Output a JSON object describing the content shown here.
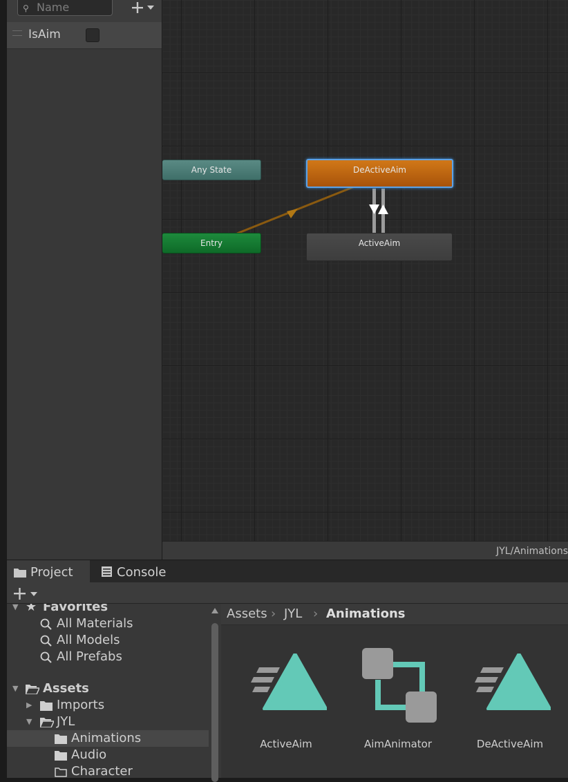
{
  "parameters": {
    "search_placeholder": "Name",
    "add_icon": "plus-icon",
    "items": [
      {
        "name": "IsAim",
        "type": "bool",
        "checked": false
      }
    ]
  },
  "graph": {
    "nodes": {
      "any_state": "Any State",
      "entry": "Entry",
      "deactive_aim": "DeActiveAim",
      "active_aim": "ActiveAim"
    },
    "default_state": "DeActiveAim",
    "path_label": "JYL/Animations"
  },
  "bottom": {
    "tabs": [
      {
        "label": "Project",
        "icon": "folder-icon",
        "active": true
      },
      {
        "label": "Console",
        "icon": "console-icon",
        "active": false
      }
    ],
    "tree": {
      "favorites": {
        "label": "Favorites",
        "items": [
          "All Materials",
          "All Models",
          "All Prefabs"
        ]
      },
      "assets": {
        "label": "Assets",
        "children": [
          "Imports",
          "JYL"
        ],
        "jyl_children": [
          "Animations",
          "Audio",
          "Character"
        ],
        "selected": "Animations"
      }
    },
    "breadcrumb": [
      "Assets",
      "JYL",
      "Animations"
    ],
    "asset_items": [
      {
        "name": "ActiveAim",
        "icon": "animation-clip-icon"
      },
      {
        "name": "AimAnimator",
        "icon": "animator-controller-icon"
      },
      {
        "name": "DeActiveAim",
        "icon": "animation-clip-icon"
      }
    ]
  },
  "colors": {
    "any_state": "#4a7c76",
    "entry": "#167a33",
    "default_state": "#c46c12",
    "selection_outline": "#5ea2e6",
    "asset_icon": "#63c9b7"
  }
}
